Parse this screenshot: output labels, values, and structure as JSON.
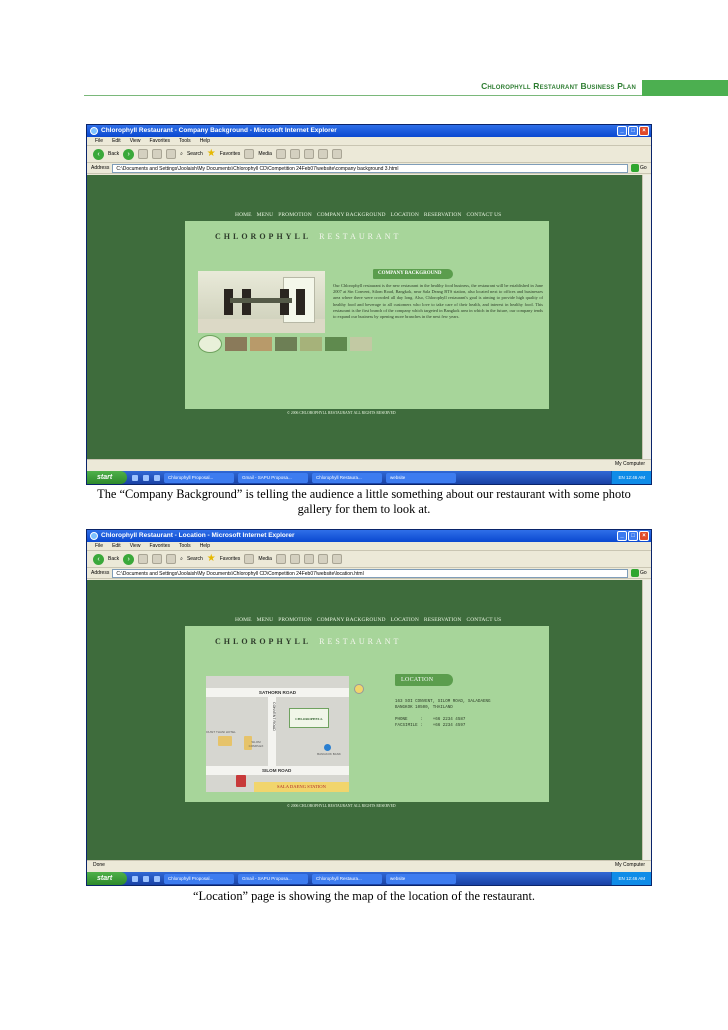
{
  "header": {
    "title": "Chlorophyll Restaurant Business Plan"
  },
  "screenshot1": {
    "window_title": "Chlorophyll Restaurant - Company Background - Microsoft Internet Explorer",
    "menu": [
      "File",
      "Edit",
      "View",
      "Favorites",
      "Tools",
      "Help"
    ],
    "toolbar": {
      "back": "Back",
      "search": "Search",
      "favorites": "Favorites",
      "media": "Media"
    },
    "address_label": "Address",
    "address": "C:\\Documents and Settings\\Joolaish\\My Documents\\Chlorophyll CD\\Competition 24Feb07\\website\\company background 3.html",
    "go": "Go",
    "site_nav": [
      "HOME",
      "MENU",
      "PROMOTION",
      "COMPANY BACKGROUND",
      "LOCATION",
      "RESERVATION",
      "CONTACT US"
    ],
    "brand": {
      "name": "CHLOROPHYLL",
      "sub": "RESTAURANT"
    },
    "section_title": "COMPANY BACKGROUND",
    "body_text": "Our Chlorophyll restaurant is the new restaurant in the healthy food business, the restaurant will be established in June 2007 at Sin Convent, Silom Road, Bangkok, near Sala Deang BTS station, also located next to offices and businesses area where there were crowded all day long. Also, Chlorophyll restaurant's goal is aiming to provide high quality of healthy food and beverage to all customers who love to take care of their health, and interest in healthy food. This restaurant is the first branch of the company which targeted in Bangkok area in which in the future, our company tends to expand our business by opening more branches in the next few years.",
    "copyright": "© 2006 CHLOROPHYLL RESTAURANT ALL RIGHTS RESERVED",
    "status_left": "",
    "status_right": "My Computer",
    "taskbar": {
      "start": "start",
      "tasks": [
        "Chlorophyll Proposal...",
        "Gmail - SAPU Proposa...",
        "Chlorophyll Restaura...",
        "website"
      ],
      "tray": "EN 12:46 AM"
    }
  },
  "caption1": "The “Company Background” is telling the audience a little something about our restaurant with some photo gallery for them to look at.",
  "screenshot2": {
    "window_title": "Chlorophyll Restaurant - Location - Microsoft Internet Explorer",
    "menu": [
      "File",
      "Edit",
      "View",
      "Favorites",
      "Tools",
      "Help"
    ],
    "toolbar": {
      "back": "Back",
      "search": "Search",
      "favorites": "Favorites",
      "media": "Media"
    },
    "address_label": "Address",
    "address": "C:\\Documents and Settings\\Joolaish\\My Documents\\Chlorophyll CD\\Competition 24Feb07\\website\\location.html",
    "go": "Go",
    "site_nav": [
      "HOME",
      "MENU",
      "PROMOTION",
      "COMPANY BACKGROUND",
      "LOCATION",
      "RESERVATION",
      "CONTACT US"
    ],
    "brand": {
      "name": "CHLOROPHYLL",
      "sub": "RESTAURANT"
    },
    "section_title": "LOCATION",
    "map": {
      "road_top": "SATHORN ROAD",
      "road_bottom": "SILOM ROAD",
      "side_road": "CONVENT ROAD",
      "station": "SALA DAENG STATION",
      "logo": "CHLOROPHYLL",
      "poi_left": "DUSIT THANI HOTEL",
      "poi_mid": "SILOM COMPLEX",
      "poi_right": "BANGKOK BANK"
    },
    "address_lines": [
      "163 SOI CONVENT, SILOM ROAD, SALADAENG",
      "BANGKOK 10500, THAILAND",
      "",
      "PHONE     :    +66 2234 4587",
      "FACSIMILE :    +66 2234 4597"
    ],
    "copyright": "© 2006 CHLOROPHYLL RESTAURANT ALL RIGHTS RESERVED",
    "status_left": "Done",
    "status_right": "My Computer",
    "taskbar": {
      "start": "start",
      "tasks": [
        "Chlorophyll Proposal...",
        "Gmail - SAPU Proposa...",
        "Chlorophyll Restaura...",
        "website"
      ],
      "tray": "EN 12:46 AM"
    }
  },
  "caption2": "“Location” page is showing the map of the location of the restaurant."
}
